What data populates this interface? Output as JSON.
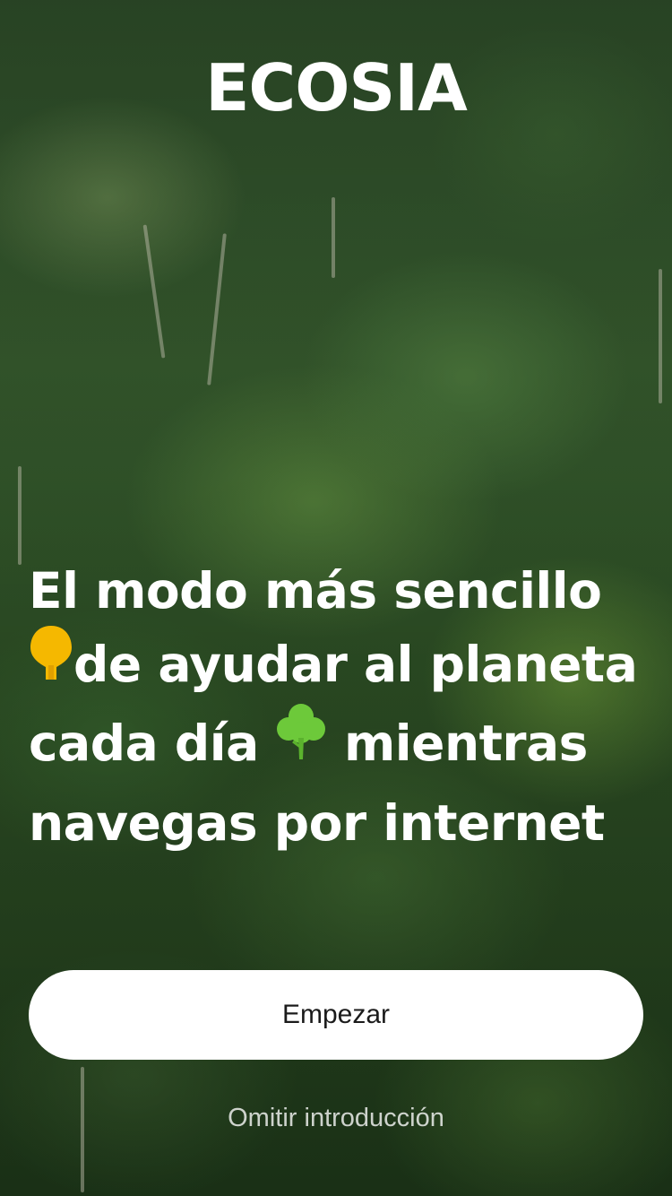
{
  "app": {
    "logo_text": "ECOSIA"
  },
  "headline": {
    "part1": "El modo más sencillo ",
    "icon1": "lightbulb-tree-icon",
    "part2": "de ayudar al planeta cada día ",
    "icon2": "tree-icon",
    "part3": " mientras navegas por internet"
  },
  "actions": {
    "primary_label": "Empezar",
    "skip_label": "Omitir introducción"
  },
  "colors": {
    "icon_yellow": "#F5B800",
    "icon_green": "#6DC93A",
    "button_bg": "#FFFFFF",
    "text": "#FFFFFF"
  }
}
